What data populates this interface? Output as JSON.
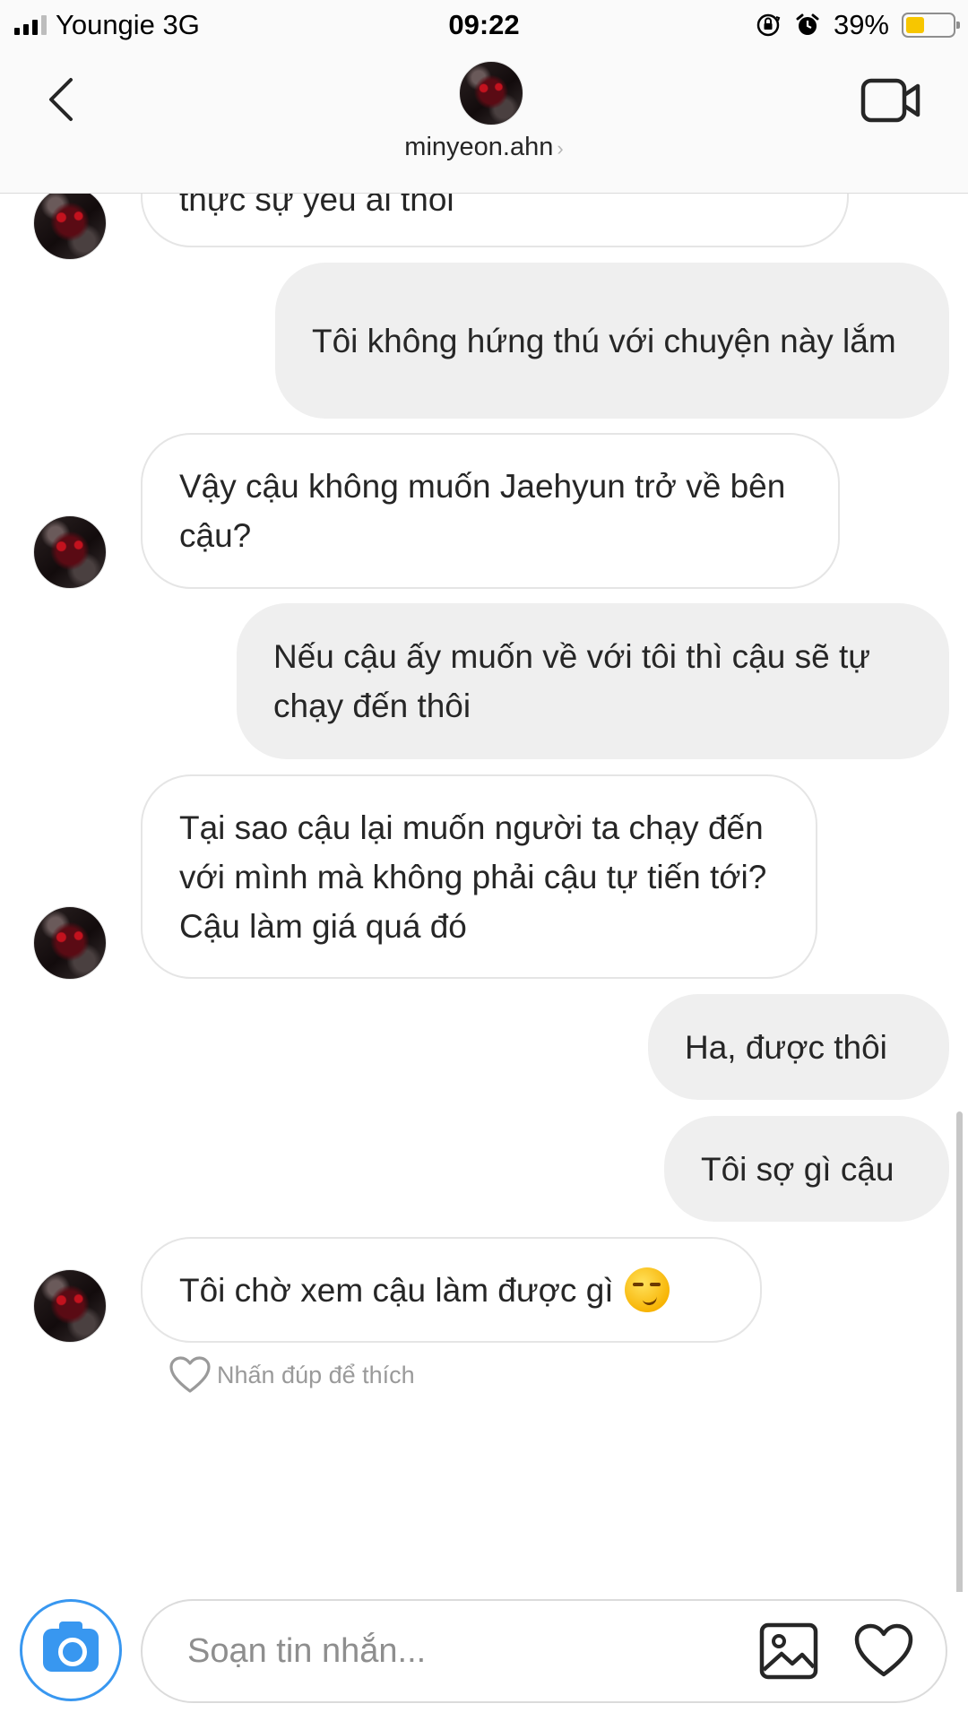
{
  "status_bar": {
    "carrier": "Youngie 3G",
    "time": "09:22",
    "battery_percent": "39%",
    "battery_level": 0.39,
    "icons": [
      "signal-icon",
      "orientation-lock-icon",
      "alarm-icon",
      "battery-icon"
    ]
  },
  "header": {
    "username": "minyeon.ahn",
    "chevron": "›",
    "icons": [
      "back-arrow-icon",
      "video-call-icon"
    ]
  },
  "messages": [
    {
      "side": "in",
      "text": "thực sự yêu ai thôi",
      "avatar": true
    },
    {
      "side": "out",
      "text": "Tôi không hứng thú với chuyện này lắm"
    },
    {
      "side": "in",
      "text": "Vậy cậu không muốn Jaehyun trở về bên cậu?",
      "avatar": true
    },
    {
      "side": "out",
      "text": "Nếu cậu ấy muốn về với tôi thì cậu sẽ tự chạy đến thôi"
    },
    {
      "side": "in",
      "text": "Tại sao cậu lại muốn người ta chạy đến với mình mà không phải cậu tự tiến tới? Cậu làm giá quá đó",
      "avatar": true
    },
    {
      "side": "out",
      "text": "Ha, được thôi"
    },
    {
      "side": "out",
      "text": "Tôi sợ gì cậu"
    },
    {
      "side": "in",
      "text": "Tôi chờ xem cậu làm được gì",
      "emoji": "smirking-face-emoji",
      "avatar": true
    }
  ],
  "like_hint": "Nhấn đúp để thích",
  "composer": {
    "placeholder": "Soạn tin nhắn...",
    "icons": [
      "camera-icon",
      "gallery-icon",
      "heart-icon"
    ],
    "accent_color": "#3897f0"
  }
}
